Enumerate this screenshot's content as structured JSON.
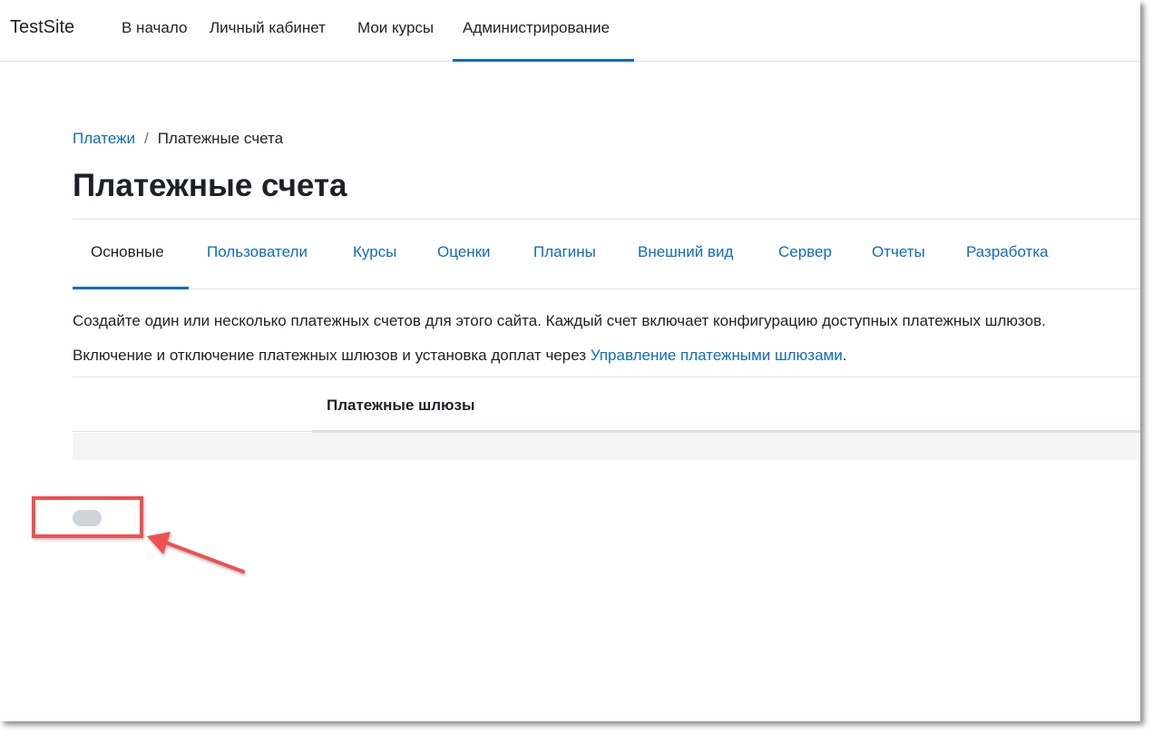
{
  "navbar": {
    "brand": "TestSite",
    "items": [
      {
        "label": "В начало"
      },
      {
        "label": "Личный кабинет"
      },
      {
        "label": "Мои курсы"
      },
      {
        "label": "Администрирование",
        "active": true
      }
    ]
  },
  "breadcrumb": {
    "parent": "Платежи",
    "separator": "/",
    "current": "Платежные счета"
  },
  "page_title": "Платежные счета",
  "tabs": [
    {
      "label": "Основные",
      "active": true
    },
    {
      "label": "Пользователи"
    },
    {
      "label": "Курсы"
    },
    {
      "label": "Оценки"
    },
    {
      "label": "Плагины"
    },
    {
      "label": "Внешний вид"
    },
    {
      "label": "Сервер"
    },
    {
      "label": "Отчеты"
    },
    {
      "label": "Разработка"
    }
  ],
  "intro_text": "Создайте один или несколько платежных счетов для этого сайта. Каждый счет включает конфигурацию доступных платежных шлюзов.",
  "manage_text": {
    "prefix": "Включение и отключение платежных шлюзов и установка доплат через ",
    "link": "Управление платежными шлюзами",
    "suffix": "."
  },
  "table": {
    "columns": [
      "Платежные шлюзы"
    ]
  },
  "colors": {
    "accent": "#0f6cbf",
    "annotation": "#f05050",
    "placeholder": "#ced4da"
  }
}
